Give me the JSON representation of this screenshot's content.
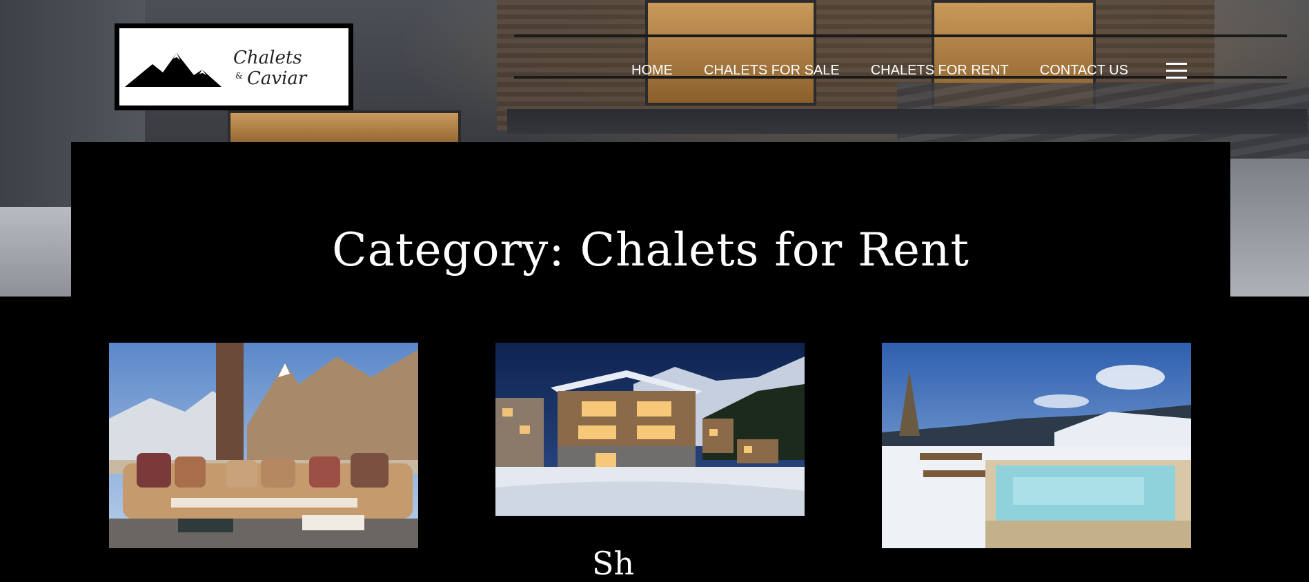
{
  "logo": {
    "line1": "Chalets",
    "amp": "&",
    "line2": "Caviar"
  },
  "nav": {
    "items": [
      {
        "label": "HOME"
      },
      {
        "label": "CHALETS FOR SALE"
      },
      {
        "label": "CHALETS FOR RENT"
      },
      {
        "label": "CONTACT US"
      }
    ],
    "menu_icon": "hamburger-icon"
  },
  "page": {
    "title": "Category: Chalets for Rent"
  },
  "posts": [
    {
      "image": "living-room-matterhorn-view"
    },
    {
      "image": "chalet-exterior-snow-night",
      "title_partial": "Sh"
    },
    {
      "image": "hot-tub-snowy-terrace"
    }
  ],
  "colors": {
    "background": "#000000",
    "text": "#ffffff"
  }
}
